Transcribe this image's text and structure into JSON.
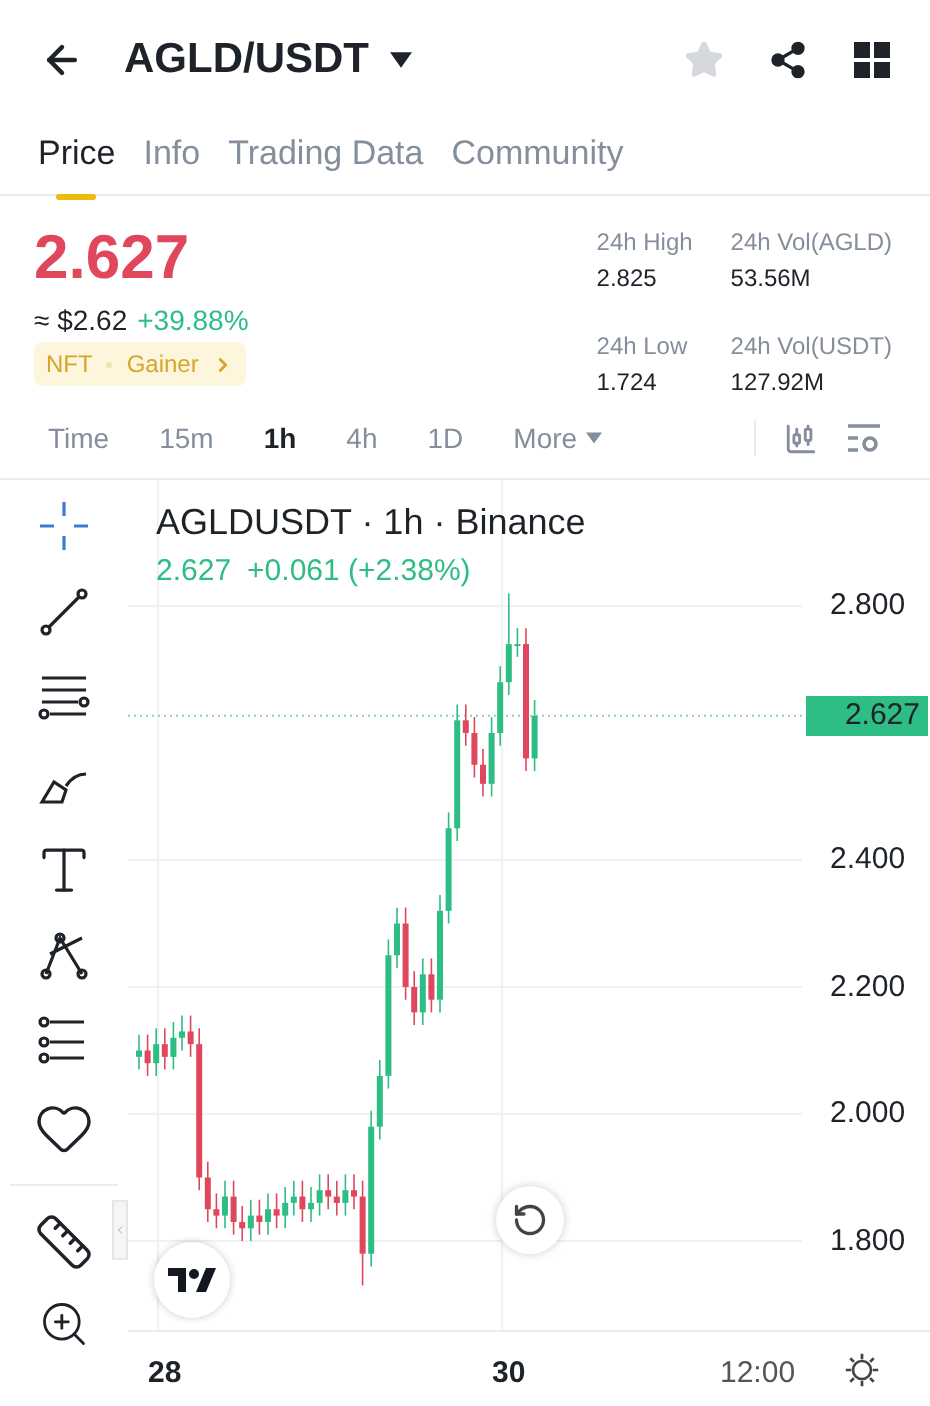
{
  "header": {
    "title": "AGLD/USDT",
    "favorite": false
  },
  "tabs": [
    {
      "label": "Price",
      "selected": true
    },
    {
      "label": "Info",
      "selected": false
    },
    {
      "label": "Trading Data",
      "selected": false
    },
    {
      "label": "Community",
      "selected": false
    }
  ],
  "price": {
    "last": "2.627",
    "usd": "≈ $2.62",
    "change": "+39.88%",
    "tags": [
      "NFT",
      "Gainer"
    ]
  },
  "stats": [
    {
      "label": "24h High",
      "value": "2.825"
    },
    {
      "label": "24h Vol(AGLD)",
      "value": "53.56M"
    },
    {
      "label": "24h Low",
      "value": "1.724"
    },
    {
      "label": "24h Vol(USDT)",
      "value": "127.92M"
    }
  ],
  "intervals": [
    {
      "label": "Time",
      "selected": false
    },
    {
      "label": "15m",
      "selected": false
    },
    {
      "label": "1h",
      "selected": true
    },
    {
      "label": "4h",
      "selected": false
    },
    {
      "label": "1D",
      "selected": false
    },
    {
      "label": "More",
      "selected": false
    }
  ],
  "chart": {
    "title": "AGLDUSDT · 1h · Binance",
    "quote": "2.627",
    "change": "+0.061 (+2.38%)",
    "price_labels": [
      "2.800",
      "2.400",
      "2.200",
      "2.000",
      "1.800"
    ],
    "current_label": "2.627",
    "time_labels": [
      "28",
      "30",
      "12:00"
    ]
  }
}
